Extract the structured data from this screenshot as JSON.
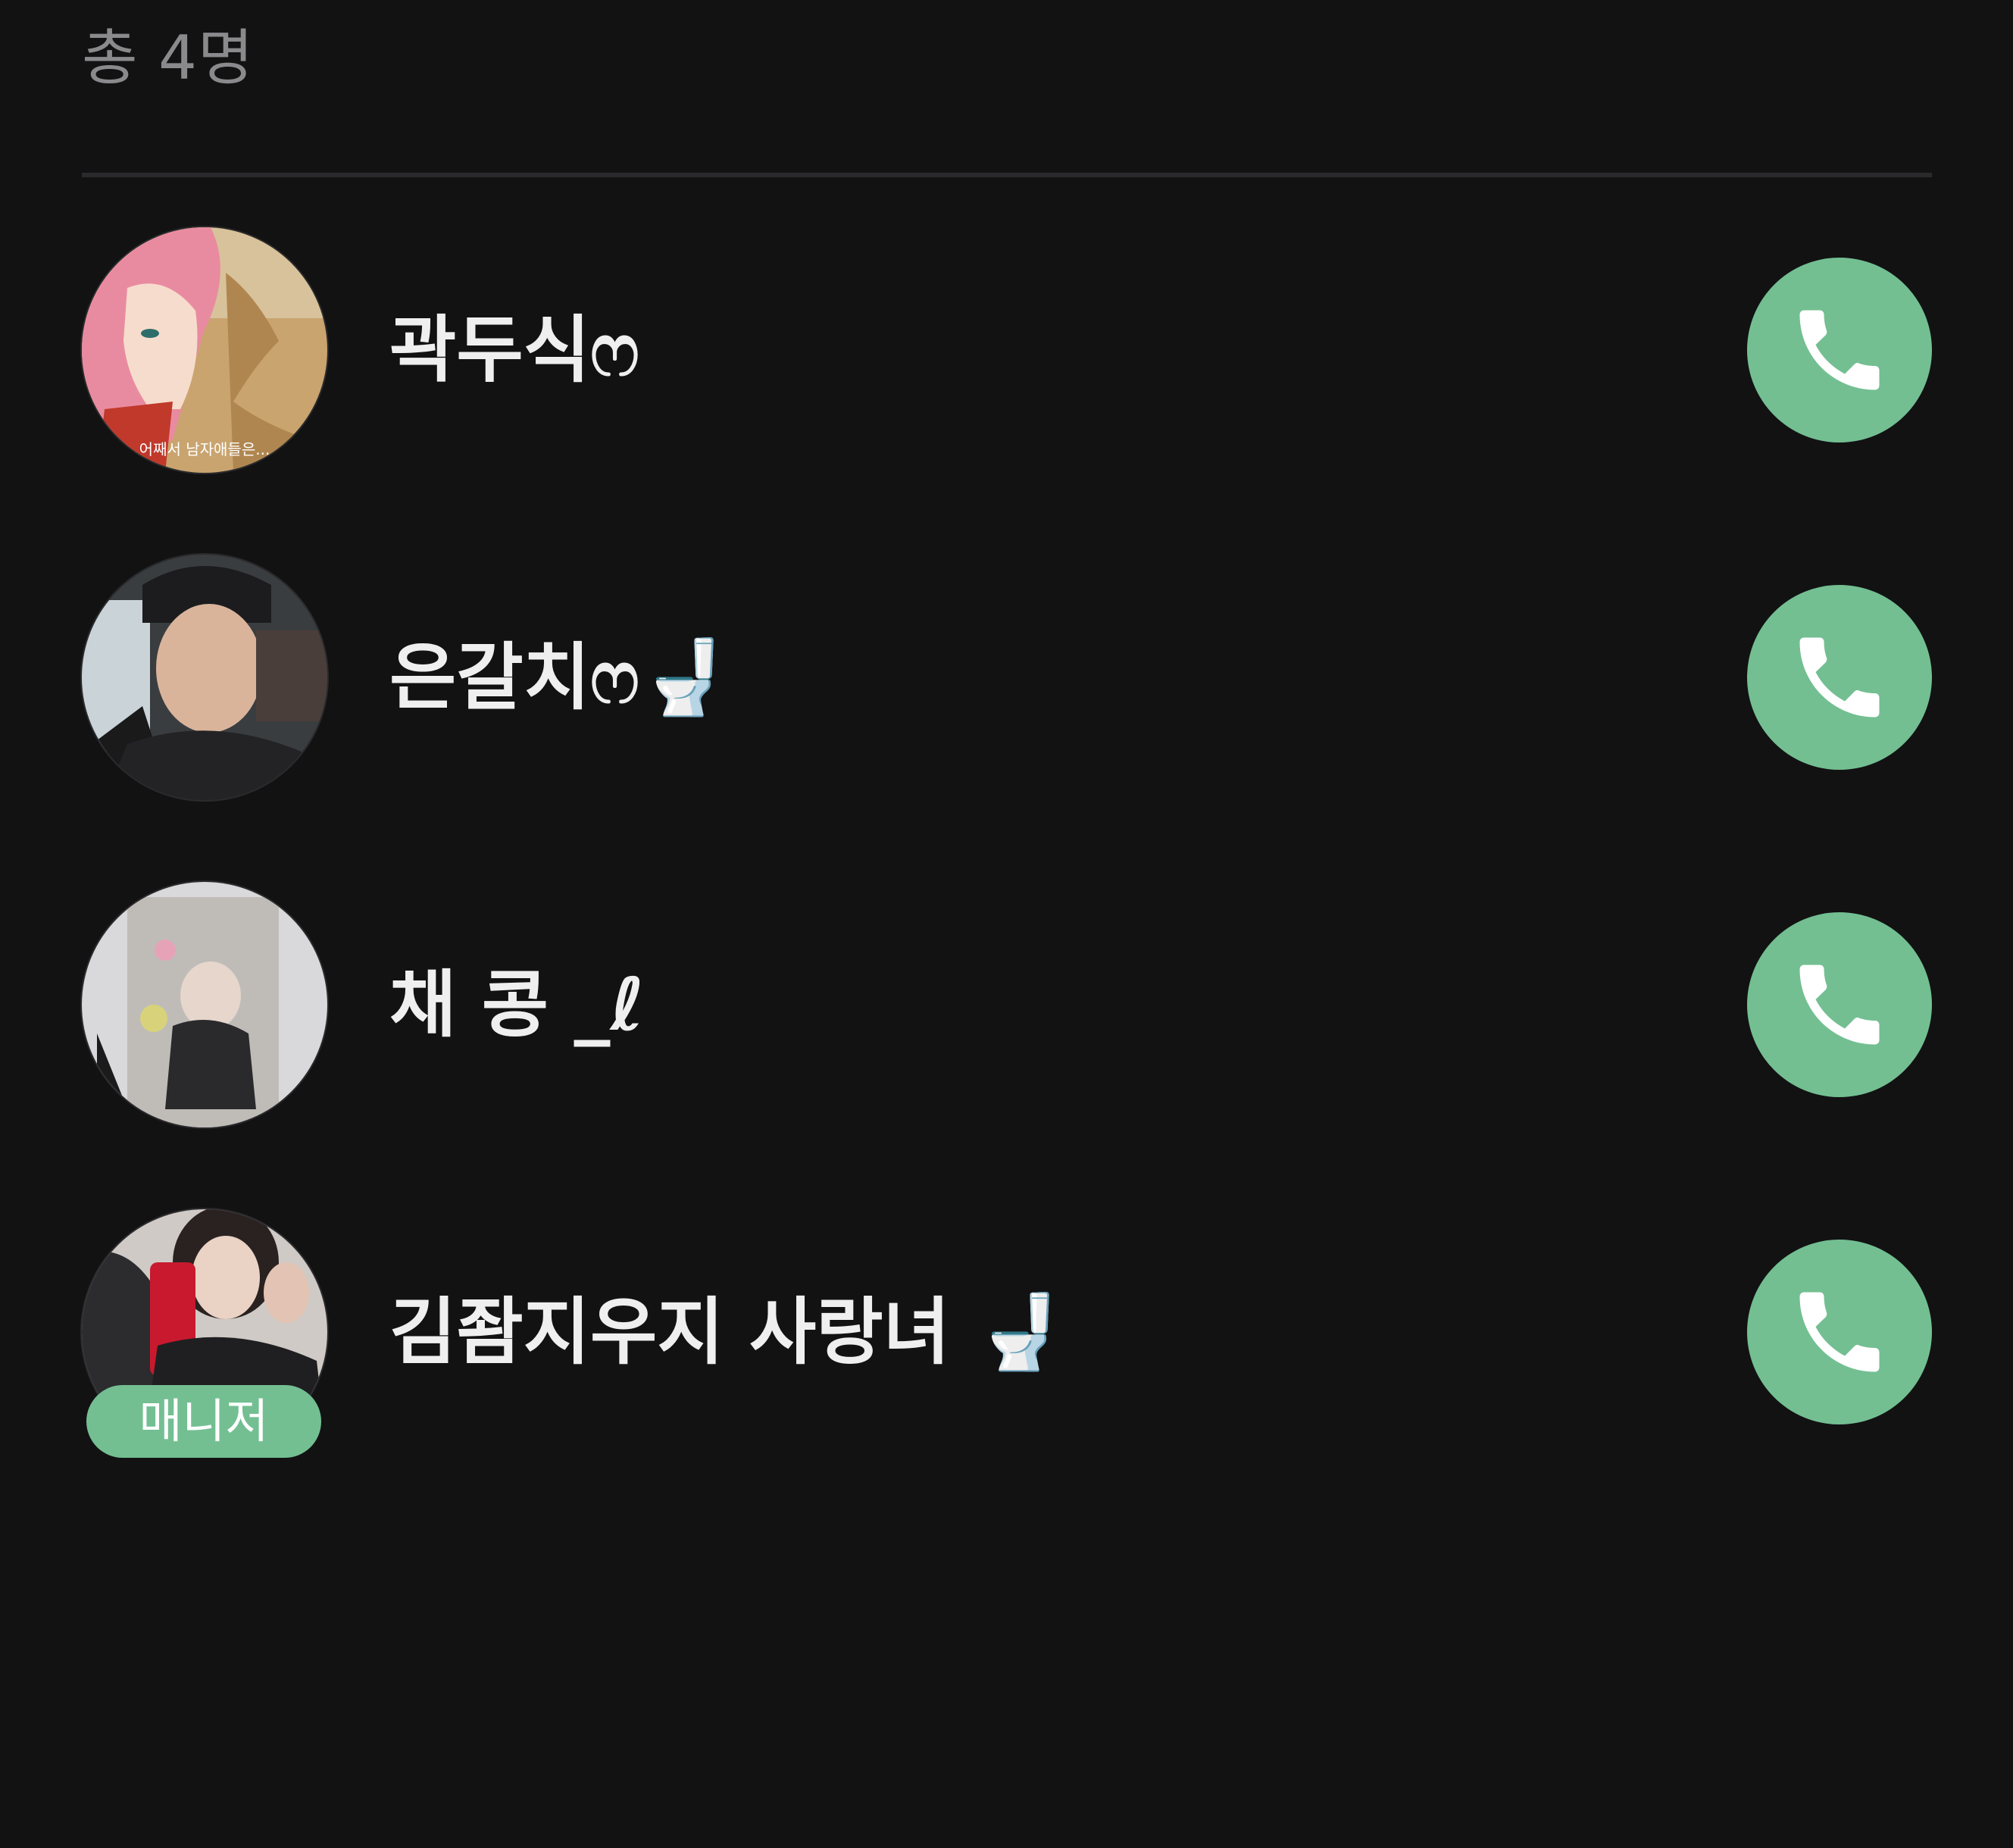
{
  "header": {
    "member_count_label": "총 4명"
  },
  "members": [
    {
      "name": "곽두식ෆ",
      "avatar_caption": "어째서 남자애들은...",
      "role": ""
    },
    {
      "name": "은갈치ෆ🚽",
      "role": ""
    },
    {
      "name": "채 콩 _ℓ",
      "role": ""
    },
    {
      "name": "김좜지우지 사랑녀 🚽",
      "role": "매니저"
    }
  ],
  "icons": {
    "call": "phone-icon"
  },
  "colors": {
    "background": "#121213",
    "accent": "#73bf92",
    "muted_text": "#8a8a8c",
    "name_text": "#efefef"
  }
}
